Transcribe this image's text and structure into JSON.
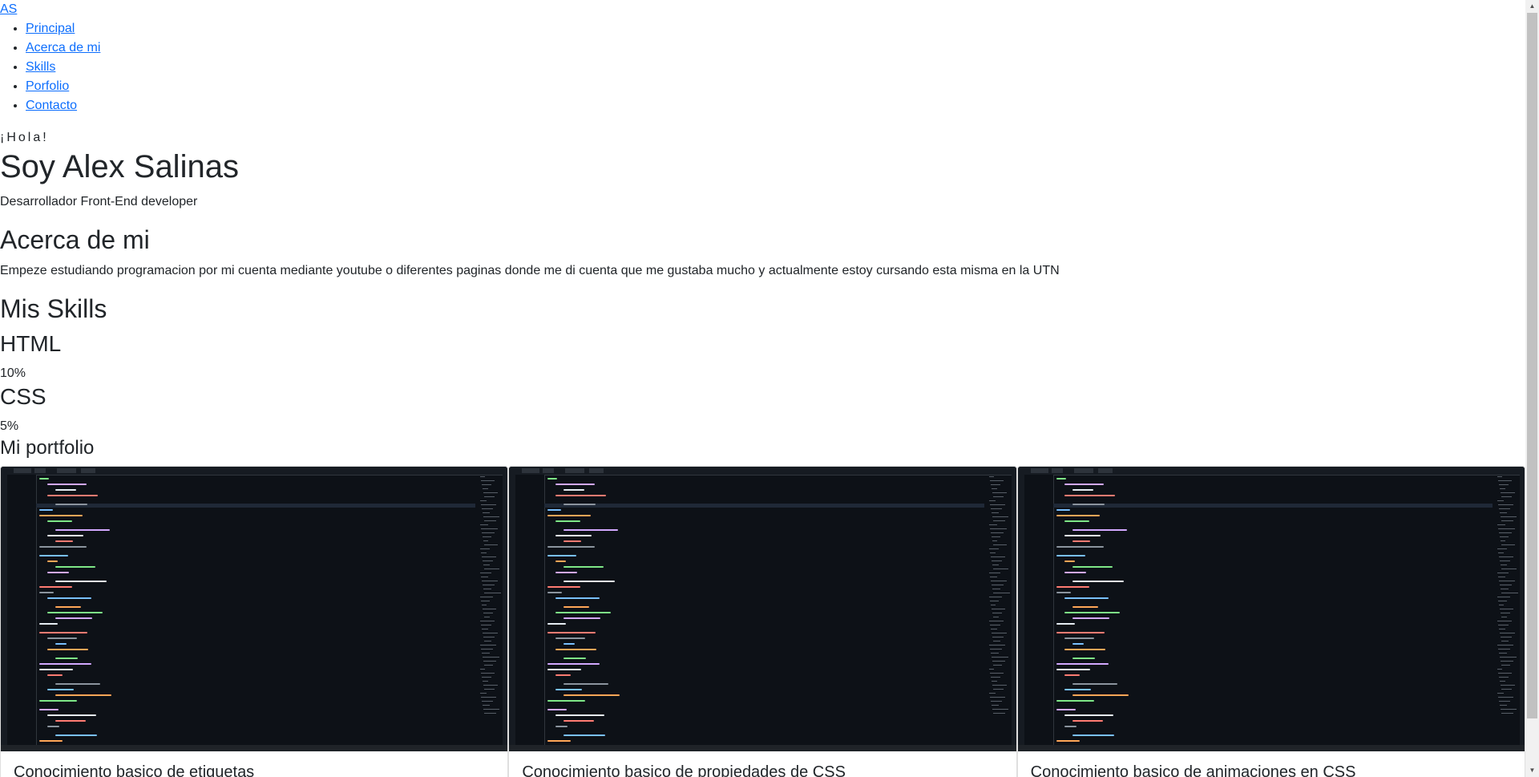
{
  "nav": {
    "brand": "AS",
    "items": [
      {
        "label": "Principal"
      },
      {
        "label": "Acerca de mi"
      },
      {
        "label": "Skills"
      },
      {
        "label": "Porfolio"
      },
      {
        "label": "Contacto"
      }
    ]
  },
  "hero": {
    "greeting": "¡Hola!",
    "name": "Soy Alex Salinas",
    "role": "Desarrollador Front-End developer"
  },
  "about": {
    "title": "Acerca de mi",
    "text": "Empeze estudiando programacion por mi cuenta mediante youtube o diferentes paginas donde me di cuenta que me gustaba mucho y actualmente estoy cursando esta misma en la UTN"
  },
  "skills": {
    "title": "Mis Skills",
    "items": [
      {
        "name": "HTML",
        "percent": "10%"
      },
      {
        "name": "CSS",
        "percent": "5%"
      }
    ]
  },
  "portfolio": {
    "title": "Mi portfolio",
    "cards": [
      {
        "title": "Conocimiento basico de etiquetas"
      },
      {
        "title": "Conocimiento basico de propiedades de CSS"
      },
      {
        "title": "Conocimiento basico de animaciones en CSS"
      }
    ]
  },
  "colors": {
    "link": "#0d6efd",
    "text": "#212529",
    "editor_bg": "#0d1117"
  }
}
